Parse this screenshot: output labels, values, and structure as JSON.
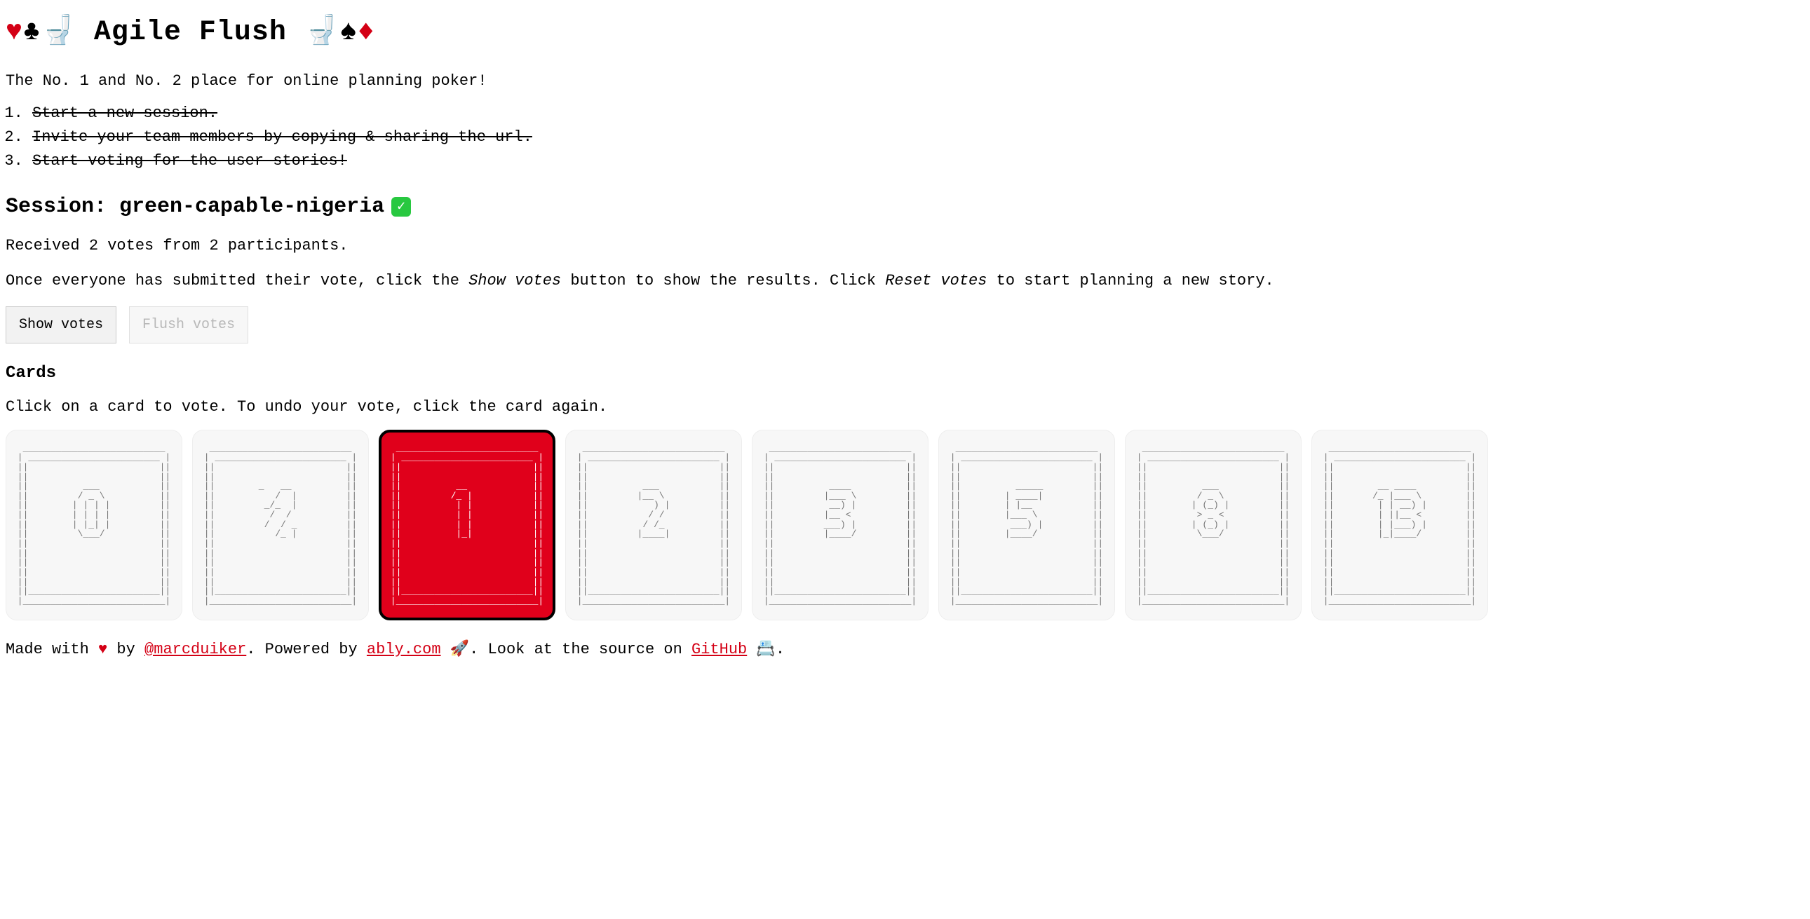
{
  "header": {
    "suits_left_red": "♥",
    "suits_left_black": "♣",
    "toilet": "🚽",
    "title": "Agile Flush",
    "suits_right_black": "♠",
    "suits_right_red": "♦"
  },
  "tagline": "The No. 1 and No. 2 place for online planning poker!",
  "steps": [
    "Start a new session.",
    "Invite your team members by copying & sharing the url.",
    "Start voting for the user stories!"
  ],
  "session": {
    "prefix": "Session: ",
    "name": "green-capable-nigeria",
    "checkmark": "✓"
  },
  "votes_received": "Received 2 votes from 2 participants.",
  "instructions": {
    "part1": "Once everyone has submitted their vote, click the ",
    "em1": "Show votes",
    "part2": " button to show the results. Click ",
    "em2": "Reset votes",
    "part3": " to start planning a new story."
  },
  "buttons": {
    "show_votes": "Show votes",
    "flush_votes": "Flush votes"
  },
  "cards_heading": "Cards",
  "cards_hint": "Click on a card to vote. To undo your vote, click the card again.",
  "cards": [
    {
      "value": "0",
      "selected": false
    },
    {
      "value": "1/2",
      "selected": false
    },
    {
      "value": "1",
      "selected": true
    },
    {
      "value": "2",
      "selected": false
    },
    {
      "value": "3",
      "selected": false
    },
    {
      "value": "5",
      "selected": false
    },
    {
      "value": "8",
      "selected": false
    },
    {
      "value": "13",
      "selected": false
    }
  ],
  "footer": {
    "made_with": "Made with ",
    "heart": "♥",
    "by": " by ",
    "author": "@marcduiker",
    "powered": ". Powered by ",
    "ably": "ably.com",
    "rocket": " 🚀",
    "look": ". Look at the source on ",
    "github": "GitHub",
    "box": " 📇",
    "period": "."
  }
}
